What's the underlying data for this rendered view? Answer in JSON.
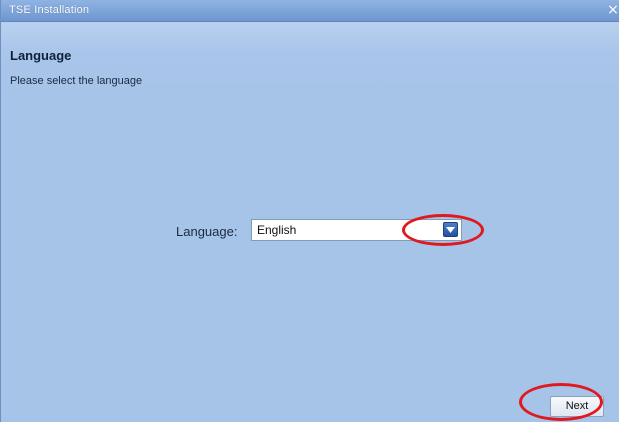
{
  "window": {
    "title": "TSE Installation",
    "close_symbol": "×"
  },
  "page": {
    "title": "Language",
    "subtitle": "Please select the language"
  },
  "language": {
    "label": "Language:",
    "selected": "English"
  },
  "footer": {
    "next_label": "Next"
  },
  "icons": {
    "close": "close-icon",
    "dropdown": "chevron-down-icon"
  },
  "colors": {
    "window_background": "#a6c3e8",
    "titlebar": "#7aa0d8",
    "annotation": "#e0191e",
    "dropdown_button": "#2f5ea8"
  }
}
